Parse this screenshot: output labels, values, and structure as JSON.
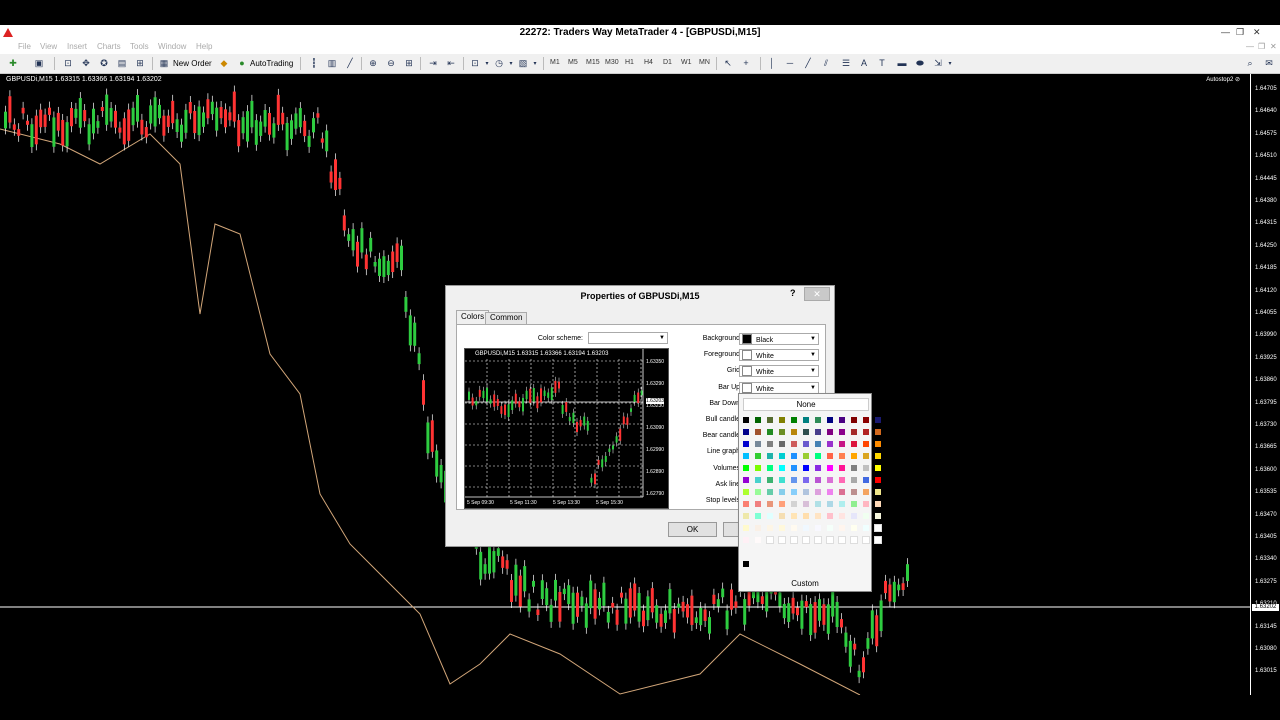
{
  "window": {
    "title": "22272: Traders Way MetaTrader 4 - [GBPUSDi,M15]"
  },
  "menu": [
    "File",
    "View",
    "Insert",
    "Charts",
    "Tools",
    "Window",
    "Help"
  ],
  "toolbar": {
    "new_order_label": "New Order",
    "autotrading_label": "AutoTrading",
    "timeframes": [
      "M1",
      "M5",
      "M15",
      "M30",
      "H1",
      "H4",
      "D1",
      "W1",
      "MN"
    ],
    "search_placeholder": ""
  },
  "chart": {
    "info": "GBPUSDi,M15  1.63315 1.63366 1.63194 1.63202",
    "autostop_label": "Autostop2 ⊘",
    "price_levels": [
      "1.64705",
      "1.64640",
      "1.64575",
      "1.64510",
      "1.64445",
      "1.64380",
      "1.64315",
      "1.64250",
      "1.64185",
      "1.64120",
      "1.64055",
      "1.63990",
      "1.63925",
      "1.63860",
      "1.63795",
      "1.63730",
      "1.63665",
      "1.63600",
      "1.63535",
      "1.63470",
      "1.63405",
      "1.63340",
      "1.63275",
      "1.63210",
      "1.63145",
      "1.63080",
      "1.63015"
    ],
    "current_price": "1.63202",
    "colors": {
      "bull": "#2ecc40",
      "bear": "#ff3333",
      "line": "#d2a679",
      "wick": "#ffffff"
    }
  },
  "dialog": {
    "title": "Properties of GBPUSDi,M15",
    "help": "?",
    "close": "✕",
    "tabs": [
      "Colors",
      "Common"
    ],
    "color_scheme_label": "Color scheme:",
    "color_scheme_value": "",
    "fields": [
      {
        "label": "Background:",
        "value": "Black",
        "swatch": "#000000"
      },
      {
        "label": "Foreground:",
        "value": "White",
        "swatch": "#ffffff"
      },
      {
        "label": "Grid:",
        "value": "White",
        "swatch": "#ffffff"
      },
      {
        "label": "Bar Up:",
        "value": "White",
        "swatch": "#ffffff"
      },
      {
        "label": "Bar Down:"
      },
      {
        "label": "Bull candle:"
      },
      {
        "label": "Bear candle:"
      },
      {
        "label": "Line graph:"
      },
      {
        "label": "Volumes:"
      },
      {
        "label": "Ask line:"
      },
      {
        "label": "Stop levels:"
      }
    ],
    "preview": {
      "info": "GBPUSDi,M15  1.63315 1.63366 1.63194 1.63203",
      "prices": [
        "1.63350",
        "1.63290",
        "1.63230",
        "1.63090",
        "1.62990",
        "1.62890",
        "1.62790"
      ],
      "current": "1.63203",
      "dates": [
        "5 Sep 09:30",
        "5 Sep 11:30",
        "5 Sep 13:30",
        "5 Sep 15:30"
      ]
    },
    "ok_label": "OK",
    "cancel_label": "C"
  },
  "palette": {
    "none_label": "None",
    "custom_label": "Custom",
    "rows": [
      [
        "#000000",
        "#006400",
        "#556b2f",
        "#808000",
        "#008000",
        "#008080",
        "#2e8b57",
        "#000080",
        "#4b0082",
        "#800000",
        "#8b0000",
        "#191970"
      ],
      [
        "#00008b",
        "#a0522d",
        "#228b22",
        "#6b8e23",
        "#b8860b",
        "#2f4f4f",
        "#483d8b",
        "#800080",
        "#8b008b",
        "#a52a2a",
        "#b22222",
        "#d2691e"
      ],
      [
        "#0000cd",
        "#778899",
        "#808080",
        "#696969",
        "#cd5c5c",
        "#6a5acd",
        "#4682b4",
        "#9932cc",
        "#c71585",
        "#dc143c",
        "#ff4500",
        "#ff8c00"
      ],
      [
        "#00bfff",
        "#32cd32",
        "#20b2aa",
        "#00ced1",
        "#1e90ff",
        "#9acd32",
        "#00ff7f",
        "#ff6347",
        "#ff7f50",
        "#ffa500",
        "#daa520",
        "#ffd700"
      ],
      [
        "#00ff00",
        "#7cfc00",
        "#00ff7f",
        "#00ffff",
        "#1e90ff",
        "#0000ff",
        "#8a2be2",
        "#ff00ff",
        "#ff1493",
        "#808080",
        "#c0c0c0",
        "#ffff00"
      ],
      [
        "#9400d3",
        "#48d1cc",
        "#3cb371",
        "#40e0d0",
        "#6495ed",
        "#7b68ee",
        "#ba55d3",
        "#da70d6",
        "#ff69b4",
        "#a9a9a9",
        "#4169e1",
        "#ff0000"
      ],
      [
        "#adff2f",
        "#98fb98",
        "#66cdaa",
        "#87ceeb",
        "#87cefa",
        "#b0c4de",
        "#dda0dd",
        "#ee82ee",
        "#db7093",
        "#bc8f8f",
        "#f4a460",
        "#f0e68c"
      ],
      [
        "#fa8072",
        "#f08080",
        "#e9967a",
        "#ffa07a",
        "#d3d3d3",
        "#d8bfd8",
        "#b0e0e6",
        "#add8e6",
        "#afeeee",
        "#90ee90",
        "#ffb6c1",
        "#ffdab9"
      ],
      [
        "#eee8aa",
        "#7fffd4",
        "#e0ffff",
        "#f5deb3",
        "#ffe4b5",
        "#ffdead",
        "#ffe4c4",
        "#ffc0cb",
        "#ffe4e1",
        "#e6e6fa",
        "#f0fff0",
        "#f5f5dc"
      ],
      [
        "#fffacd",
        "#faf0e6",
        "#fdf5e6",
        "#fff8dc",
        "#fffaf0",
        "#f0f8ff",
        "#f8f8ff",
        "#f5fffa",
        "#fff5ee",
        "#fffff0",
        "#f0ffff",
        "#ffffff"
      ],
      [
        "#fff0f5",
        "#fffafa",
        "#ffffff",
        "#ffffff",
        "#ffffff",
        "#ffffff",
        "#ffffff",
        "#ffffff",
        "#ffffff",
        "#ffffff",
        "#ffffff",
        "#ffffff"
      ]
    ],
    "custom_colors": [
      "#000000"
    ]
  }
}
